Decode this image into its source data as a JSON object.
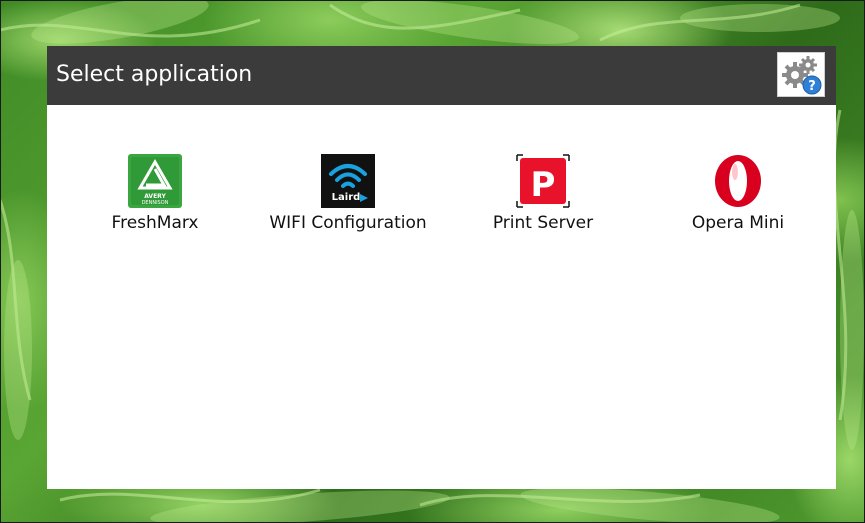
{
  "window": {
    "title": "Select application"
  },
  "settings_button": {
    "icon": "gears-help-icon"
  },
  "apps": [
    {
      "label": "FreshMarx",
      "icon": "avery-dennison-icon",
      "icon_text": "AVERY DENNISON",
      "color": "#3aa640"
    },
    {
      "label": "WIFI Configuration",
      "icon": "laird-wifi-icon",
      "icon_text": "Laird",
      "color": "#111111"
    },
    {
      "label": "Print Server",
      "icon": "print-server-icon",
      "icon_text": "P",
      "color": "#e8132b"
    },
    {
      "label": "Opera Mini",
      "icon": "opera-icon",
      "color": "#d8001e"
    }
  ]
}
